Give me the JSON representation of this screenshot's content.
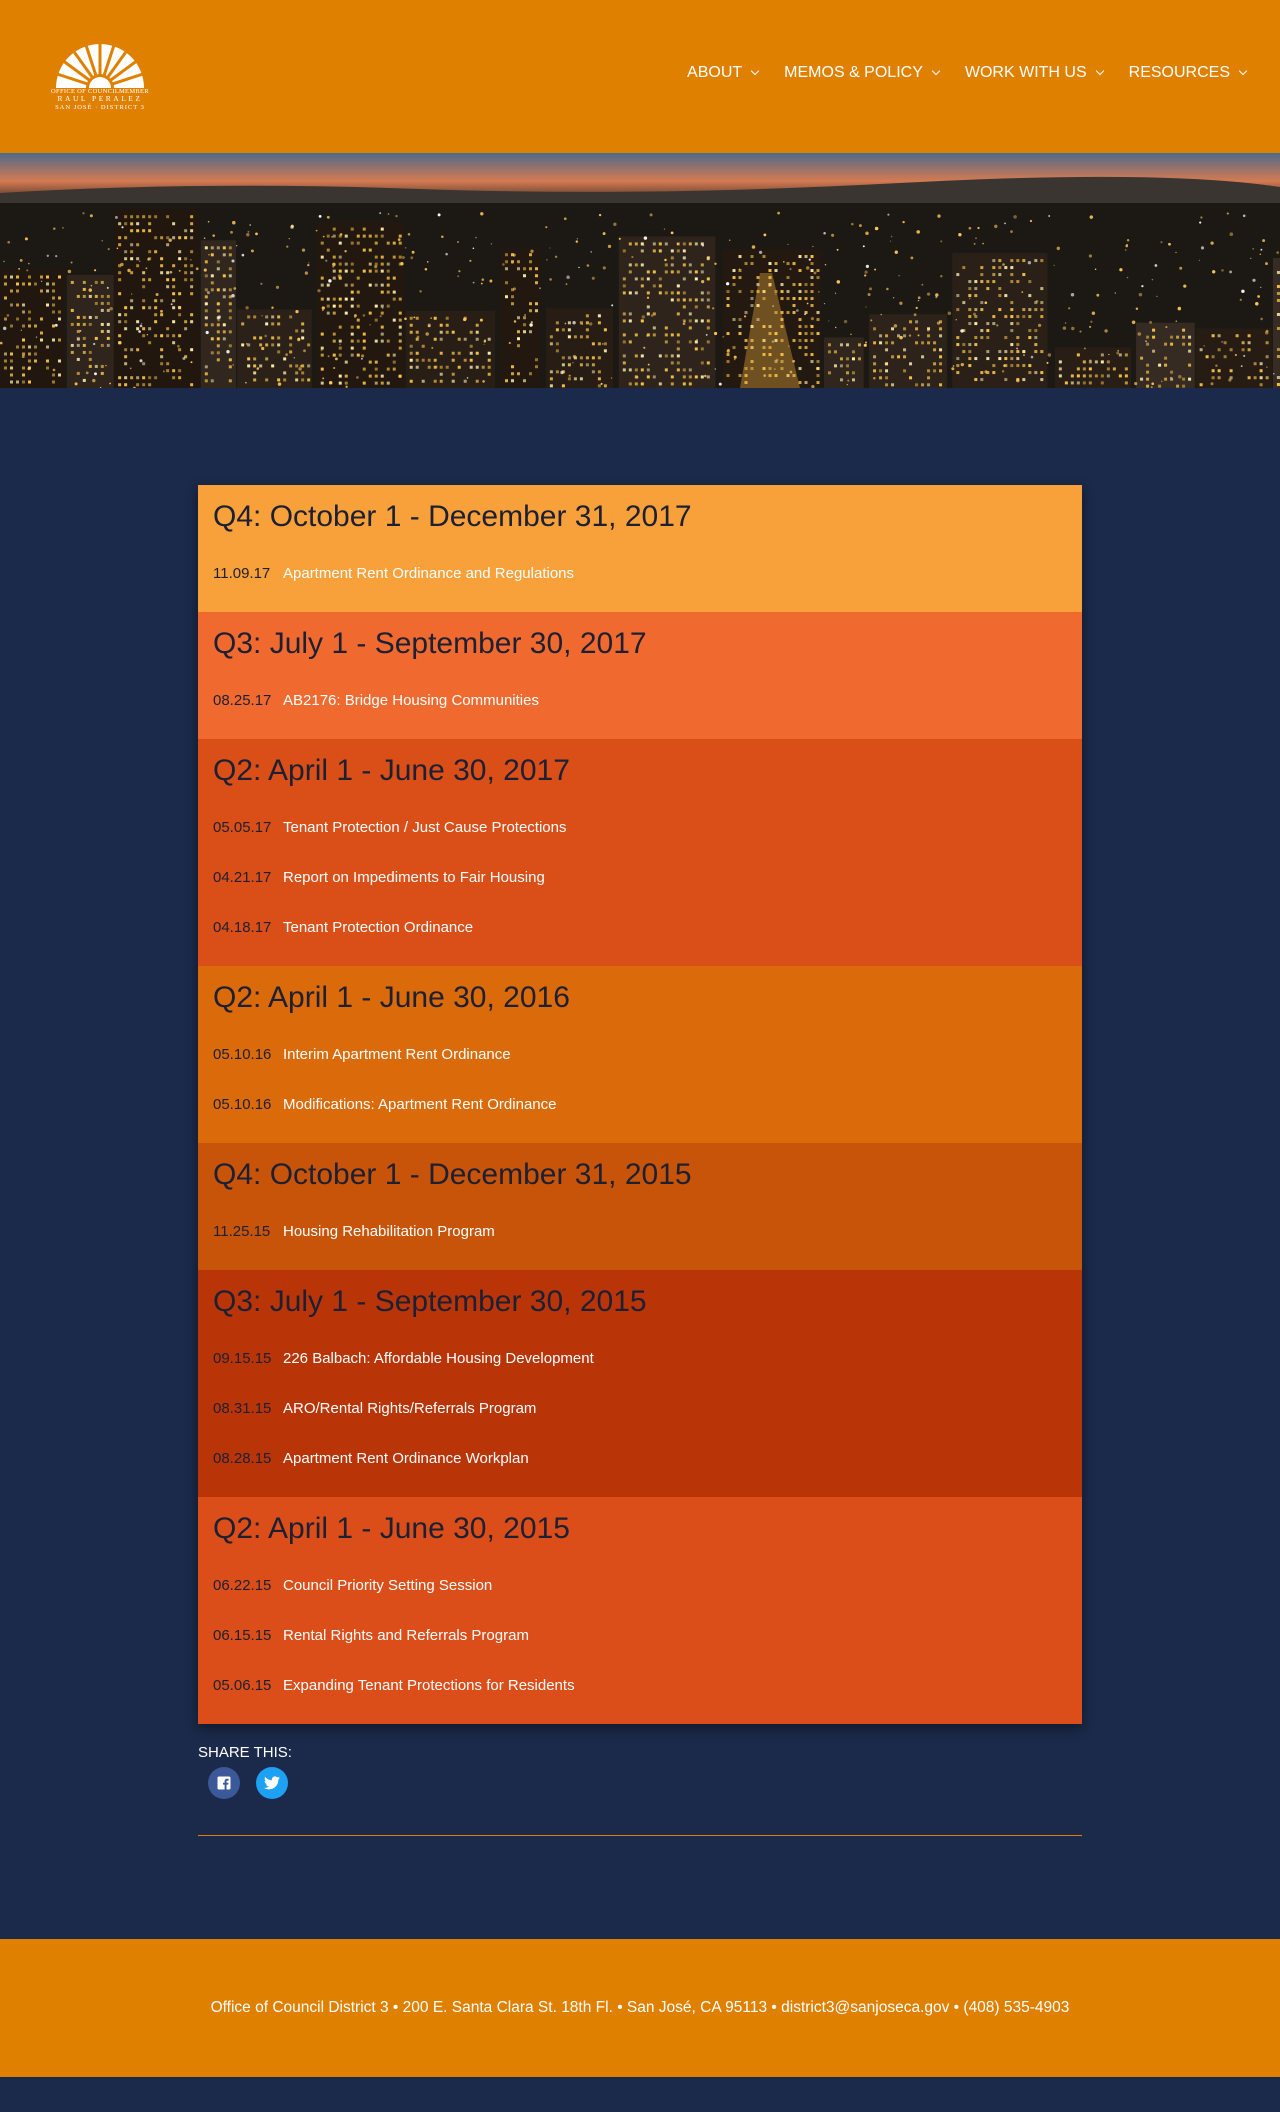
{
  "header": {
    "logo": {
      "line1": "OFFICE OF COUNCILMEMBER",
      "line2": "RAUL PERALEZ",
      "line3": "SAN JOSÉ · DISTRICT 3"
    },
    "nav": [
      {
        "label": "ABOUT",
        "icon": "chevron-down-icon"
      },
      {
        "label": "MEMOS & POLICY",
        "icon": "chevron-down-icon"
      },
      {
        "label": "WORK WITH US",
        "icon": "chevron-down-icon"
      },
      {
        "label": "RESOURCES",
        "icon": "chevron-down-icon"
      }
    ]
  },
  "colors": {
    "header_orange": "#e08000",
    "page_navy": "#1b2a4b",
    "heading_dark": "#1d2033",
    "quarter_bgs": [
      "#f8a03a",
      "#f06a30",
      "#da4e18",
      "#db6a0b",
      "#c85409",
      "#b93508",
      "#db4e1a"
    ]
  },
  "quarters": [
    {
      "heading": "Q4: October 1 - December 31, 2017",
      "entries": [
        {
          "date": "11.09.17",
          "title": "Apartment Rent Ordinance and Regulations"
        }
      ]
    },
    {
      "heading": "Q3: July 1 - September 30, 2017",
      "entries": [
        {
          "date": "08.25.17",
          "title": "AB2176: Bridge Housing Communities"
        }
      ]
    },
    {
      "heading": "Q2: April 1 - June 30, 2017",
      "entries": [
        {
          "date": "05.05.17",
          "title": "Tenant Protection / Just Cause Protections"
        },
        {
          "date": "04.21.17",
          "title": "Report on Impediments to Fair Housing"
        },
        {
          "date": "04.18.17",
          "title": "Tenant Protection Ordinance"
        }
      ]
    },
    {
      "heading": "Q2: April 1 - June 30, 2016",
      "entries": [
        {
          "date": "05.10.16",
          "title": "Interim Apartment Rent Ordinance"
        },
        {
          "date": "05.10.16",
          "title": "Modifications: Apartment Rent Ordinance"
        }
      ]
    },
    {
      "heading": "Q4: October 1 - December 31, 2015",
      "entries": [
        {
          "date": "11.25.15",
          "title": "Housing Rehabilitation Program"
        }
      ]
    },
    {
      "heading": "Q3: July 1 - September 30, 2015",
      "entries": [
        {
          "date": "09.15.15",
          "title": "226 Balbach: Affordable Housing Development"
        },
        {
          "date": "08.31.15",
          "title": "ARO/Rental Rights/Referrals Program"
        },
        {
          "date": "08.28.15",
          "title": "Apartment Rent Ordinance Workplan"
        }
      ]
    },
    {
      "heading": "Q2: April 1 - June 30, 2015",
      "entries": [
        {
          "date": "06.22.15",
          "title": "Council Priority Setting Session"
        },
        {
          "date": "06.15.15",
          "title": "Rental Rights and Referrals Program"
        },
        {
          "date": "05.06.15",
          "title": "Expanding Tenant Protections for Residents"
        }
      ]
    }
  ],
  "share": {
    "label": "SHARE THIS:",
    "buttons": [
      {
        "icon": "facebook-icon"
      },
      {
        "icon": "twitter-icon"
      }
    ]
  },
  "footer": {
    "text": "Office of Council District 3 • 200 E. Santa Clara St. 18th Fl. • San José, CA 95113 • district3@sanjoseca.gov • (408) 535-4903"
  }
}
